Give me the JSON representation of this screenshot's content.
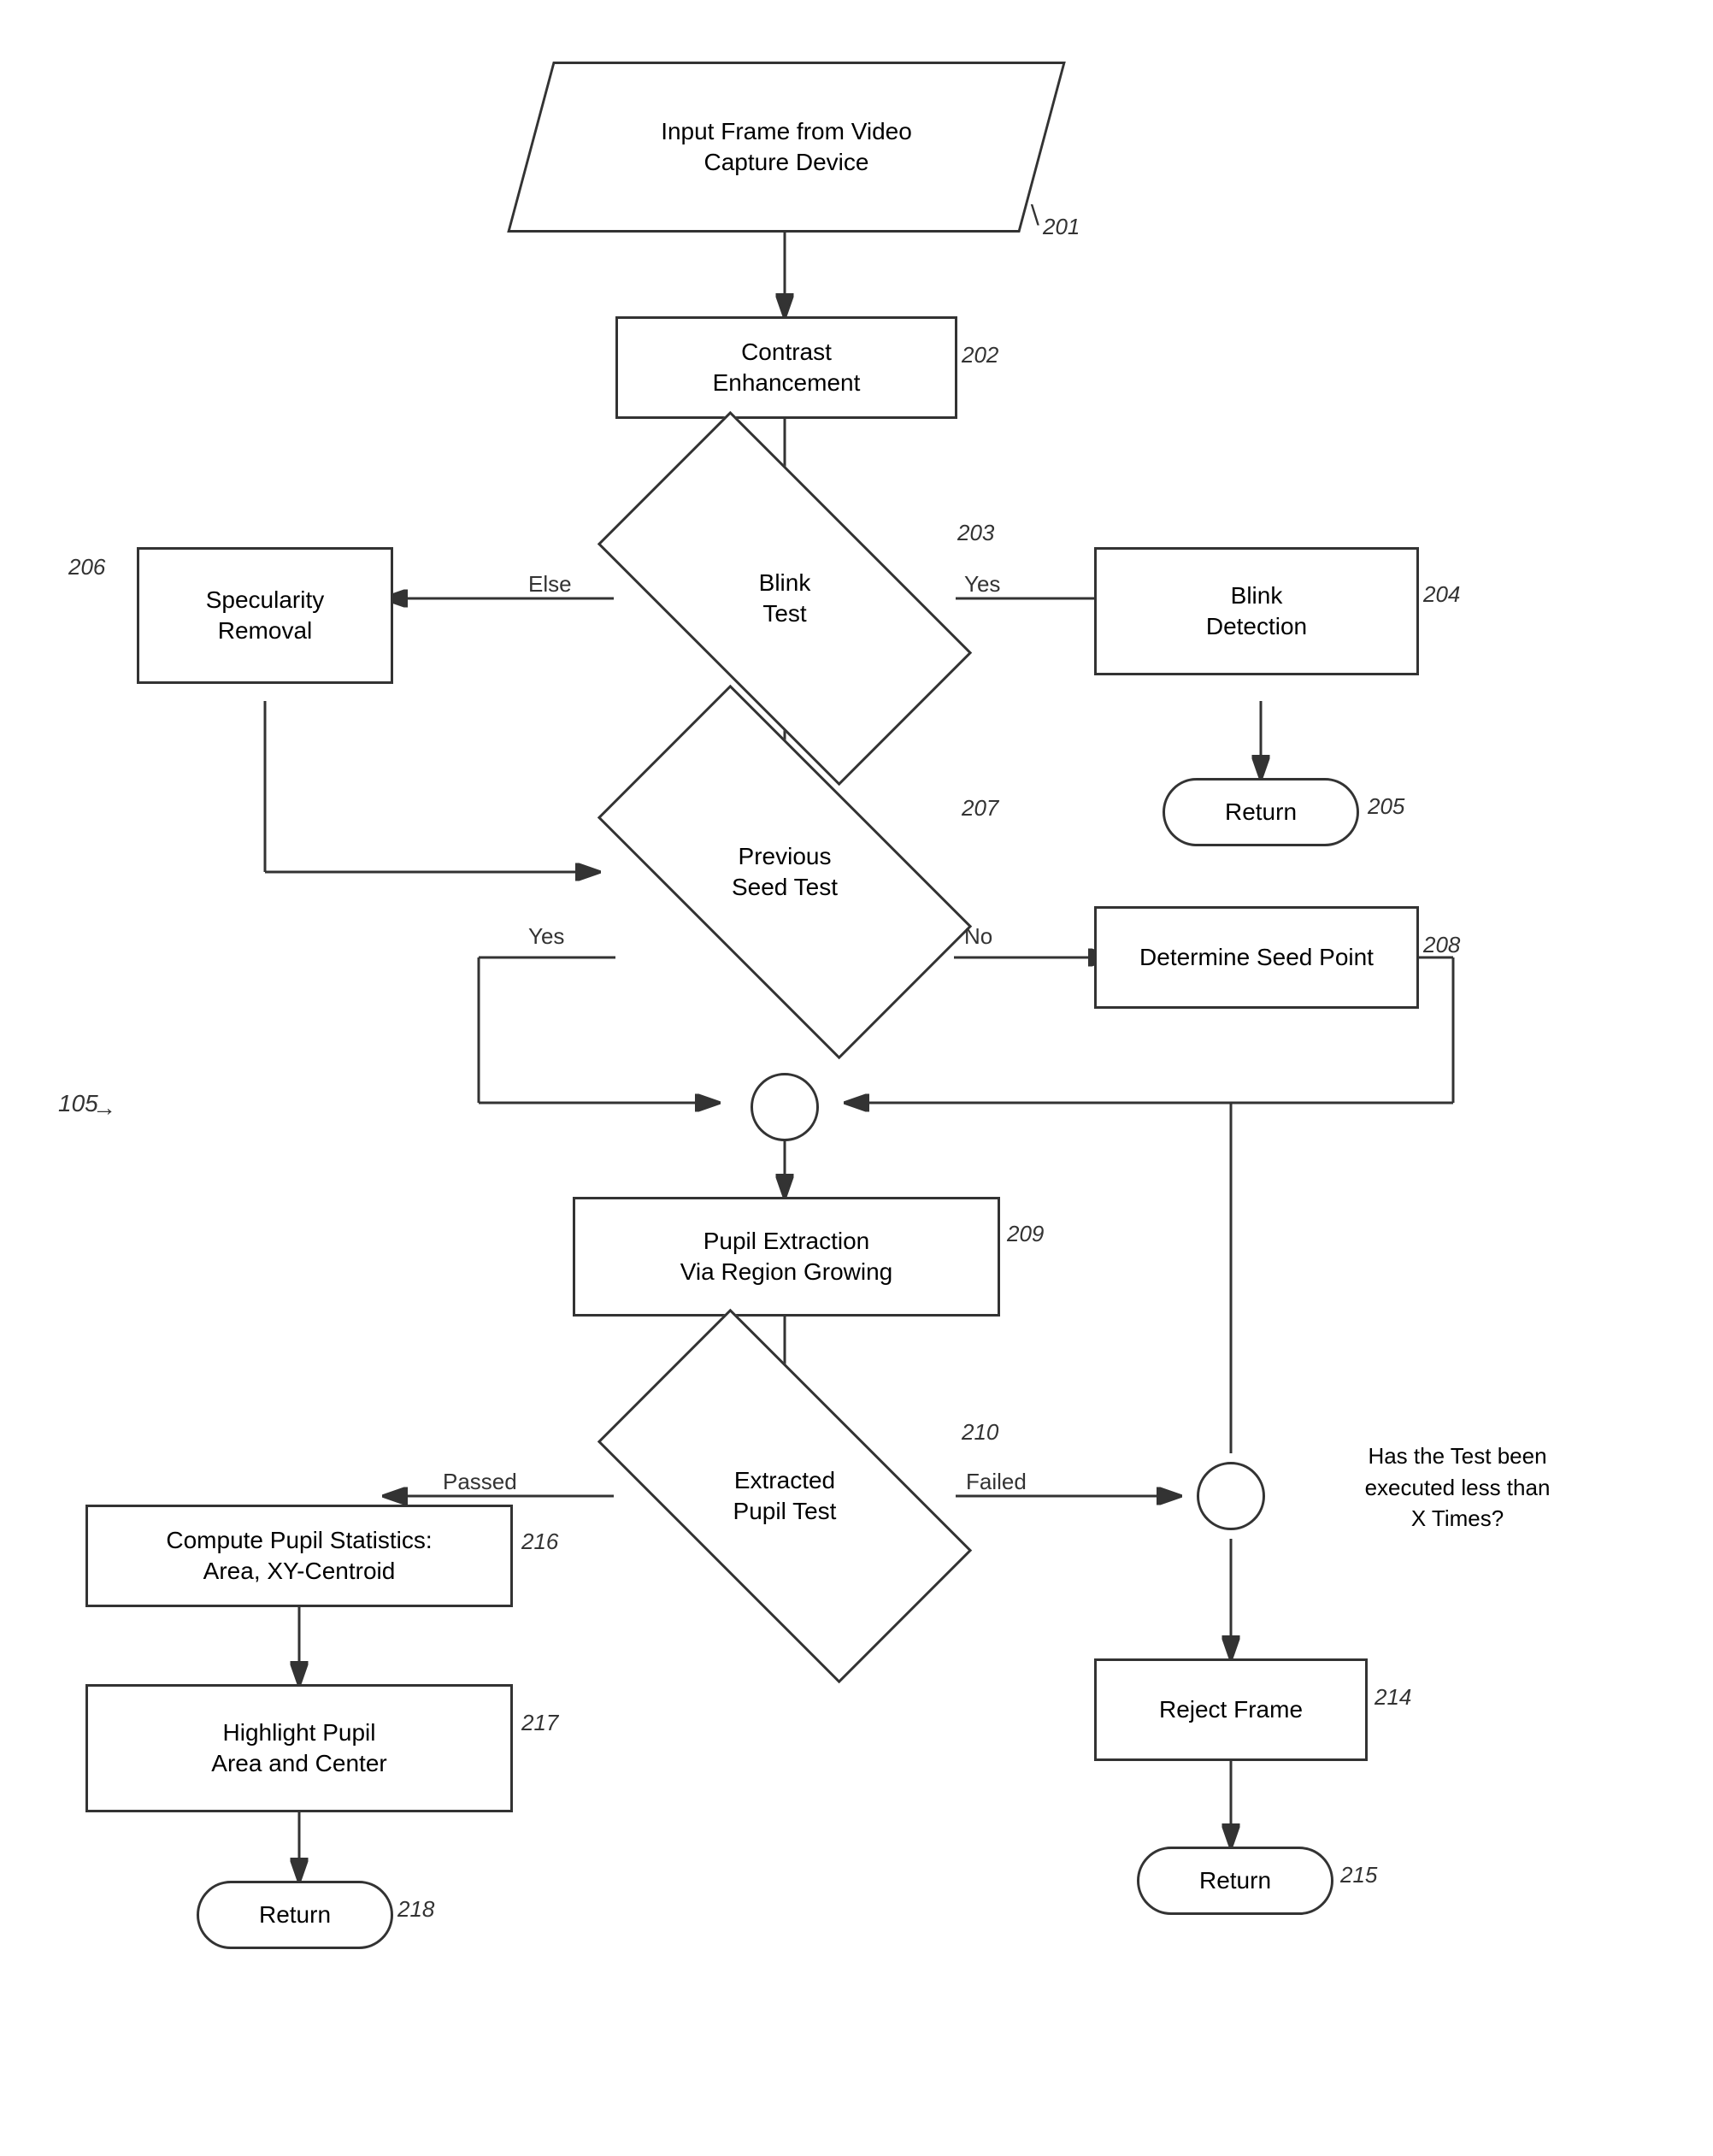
{
  "shapes": {
    "input_frame": {
      "label": "Input Frame from Video\nCapture Device",
      "ref": "201"
    },
    "contrast_enhancement": {
      "label": "Contrast\nEnhancement",
      "ref": "202"
    },
    "blink_test": {
      "label": "Blink\nTest",
      "ref": "203"
    },
    "blink_detection": {
      "label": "Blink\nDetection",
      "ref": "204"
    },
    "return_205": {
      "label": "Return",
      "ref": "205"
    },
    "specularity_removal": {
      "label": "Specularity\nRemoval",
      "ref": "206"
    },
    "previous_seed_test": {
      "label": "Previous\nSeed Test",
      "ref": "207"
    },
    "determine_seed_point": {
      "label": "Determine Seed Point",
      "ref": "208"
    },
    "ref_105": {
      "label": "105"
    },
    "pupil_extraction": {
      "label": "Pupil Extraction\nVia Region Growing",
      "ref": "209"
    },
    "extracted_pupil_test": {
      "label": "Extracted\nPupil Test",
      "ref": "210"
    },
    "circle_211": {
      "label": ""
    },
    "has_test_been": {
      "label": "Has the Test been\nexecuted less than\nX Times?"
    },
    "reject_frame": {
      "label": "Reject Frame",
      "ref": "214"
    },
    "return_215": {
      "label": "Return",
      "ref": "215"
    },
    "compute_pupil": {
      "label": "Compute Pupil Statistics:\nArea, XY-Centroid",
      "ref": "216"
    },
    "highlight_pupil": {
      "label": "Highlight Pupil\nArea and Center",
      "ref": "217"
    },
    "return_218": {
      "label": "Return",
      "ref": "218"
    },
    "junction_circle": {
      "label": ""
    }
  },
  "labels": {
    "yes_blink": "Yes",
    "else_blink": "Else",
    "yes_seed": "Yes",
    "no_seed": "No",
    "passed": "Passed",
    "failed": "Failed"
  }
}
